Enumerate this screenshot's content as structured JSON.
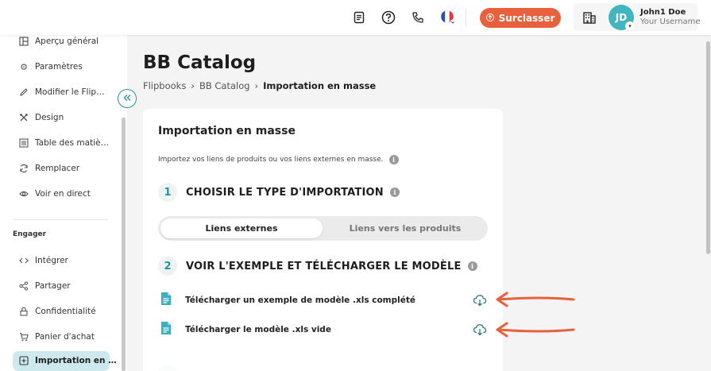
{
  "topbar": {
    "upgrade_label": "Surclasser",
    "user_name": "John1 Doe",
    "user_sub": "Your Username",
    "avatar_initials": "JD",
    "accent": "#e8603c",
    "icons": [
      "document-icon",
      "help-icon",
      "phone-icon",
      "france-flag-icon",
      "building-icon"
    ]
  },
  "sidebar": {
    "items": [
      {
        "label": "Aperçu général",
        "icon": "overview-icon"
      },
      {
        "label": "Paramètres",
        "icon": "gear-icon"
      },
      {
        "label": "Modifier le Flip…",
        "icon": "pencil-icon"
      },
      {
        "label": "Design",
        "icon": "design-tools-icon"
      },
      {
        "label": "Table des matiè…",
        "icon": "table-of-contents-icon"
      },
      {
        "label": "Remplacer",
        "icon": "replace-icon"
      },
      {
        "label": "Voir en direct",
        "icon": "eye-icon"
      }
    ],
    "section_label": "Engager",
    "engage_items": [
      {
        "label": "Intégrer",
        "icon": "code-icon"
      },
      {
        "label": "Partager",
        "icon": "share-icon"
      },
      {
        "label": "Confidentialité",
        "icon": "lock-icon"
      },
      {
        "label": "Panier d'achat",
        "icon": "cart-icon"
      },
      {
        "label": "Importation en …",
        "icon": "import-icon"
      }
    ],
    "active_color": "#cde9ee"
  },
  "page": {
    "title": "BB Catalog",
    "breadcrumb": [
      "Flipbooks",
      "BB Catalog",
      "Importation en masse"
    ]
  },
  "card": {
    "title": "Importation en masse",
    "description": "Importez vos liens de produits ou vos liens externes en masse.",
    "step1": {
      "num": "1",
      "label": "CHOISIR LE TYPE D'IMPORTATION"
    },
    "toggle": {
      "active": "Liens externes",
      "inactive": "Liens vers les produits"
    },
    "step2": {
      "num": "2",
      "label": "VOIR L'EXEMPLE ET TÉLÉCHARGER LE MODÈLE"
    },
    "downloads": [
      {
        "label": "Télécharger un exemple de modèle .xls complété"
      },
      {
        "label": "Télécharger le modèle .xls vide"
      }
    ]
  }
}
